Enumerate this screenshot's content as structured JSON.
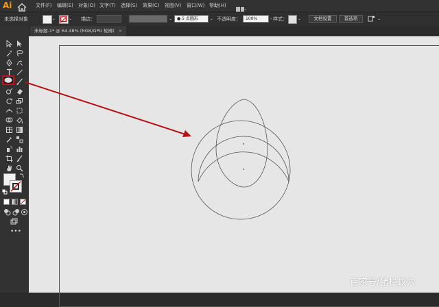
{
  "app": {
    "logo_text": "Ai"
  },
  "menu": {
    "items": [
      "文件(F)",
      "编辑(E)",
      "对象(O)",
      "文字(T)",
      "选择(S)",
      "效果(C)",
      "视图(V)",
      "窗口(W)",
      "帮助(H)"
    ]
  },
  "control_bar": {
    "selection_status": "未选择对象",
    "stroke_label": "描边：",
    "brush_label": "5 点圆形",
    "opacity_label": "不透明度：",
    "opacity_value": "100%",
    "style_label": "样式：",
    "doc_setup_button": "文档设置",
    "preferences_button": "首选项"
  },
  "document": {
    "tab_title": "未标题-1* @ 64.48% (RGB/GPU 轮廓)",
    "close_glyph": "×"
  },
  "watermark": {
    "text": "百家号/猪栏蚁穴"
  },
  "colors": {
    "highlight": "#c0161b",
    "arrow": "#b51217",
    "canvas": "#e6e6e6",
    "panel": "#323232",
    "outline": "#555555"
  }
}
